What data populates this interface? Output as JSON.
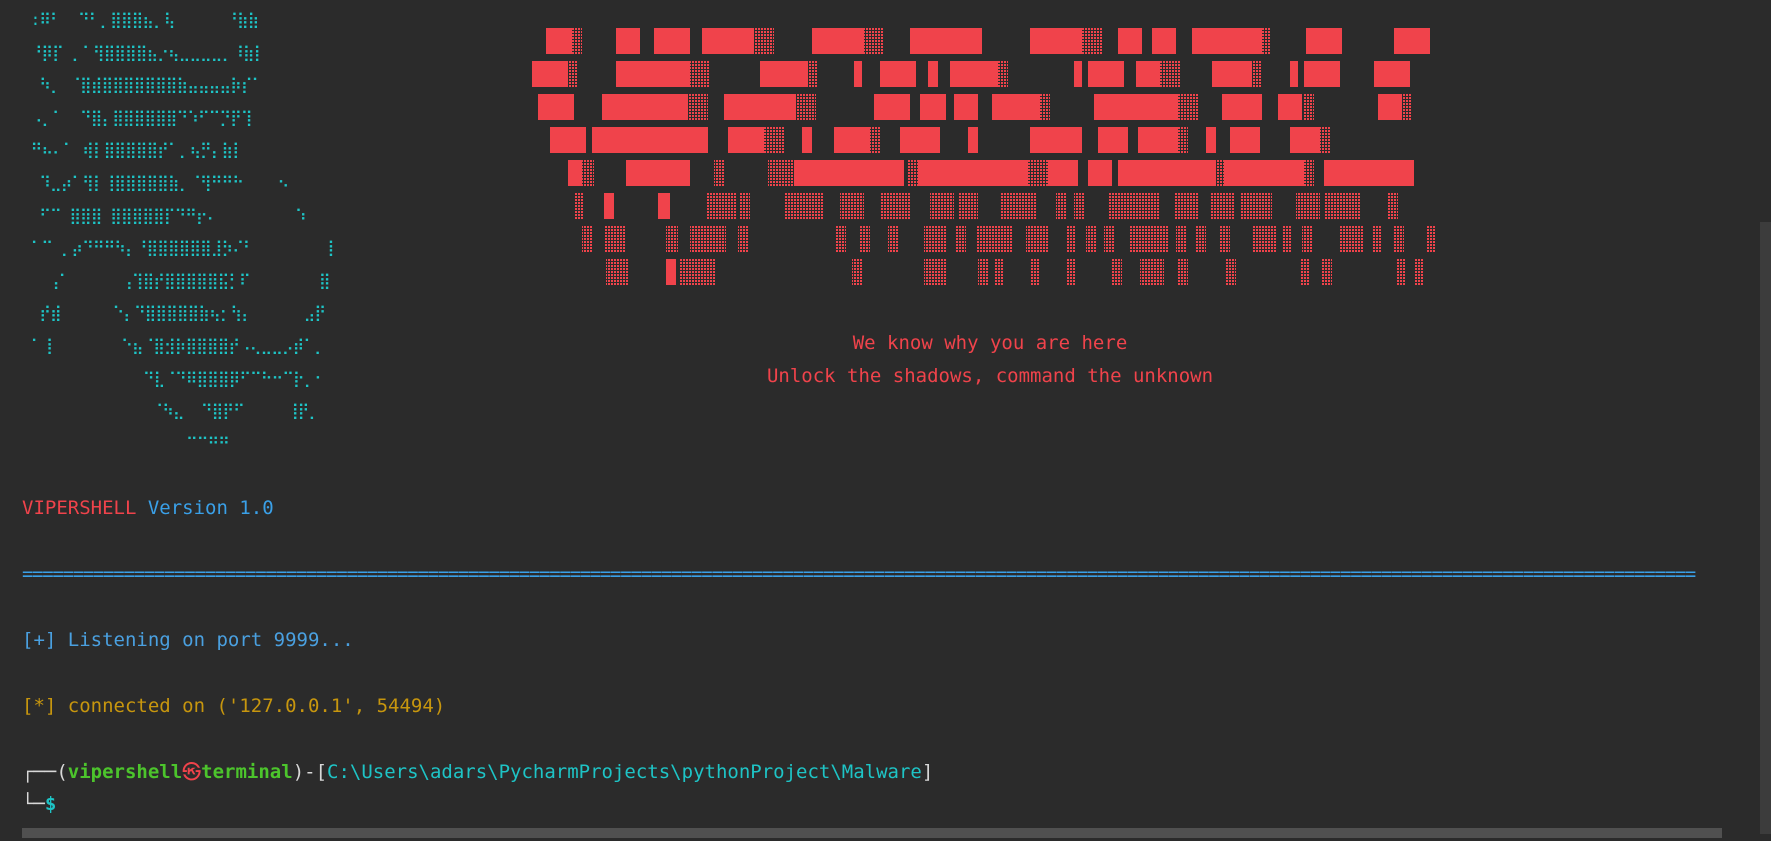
{
  "ascii_art": {
    "skull": " :⠿⠃  ⠙⠃⡀⣿⣿⣿⣦⡀⢧      ⠘⣷⣷\n ⠘⡿⡏ ⡀⠁⢻⣿⣿⣿⣿⣦⡐⢦⣀⣀⣀⣀⡀⠸⣷⡇\n  ⠳⡀ ⠈⣿⣾⣿⣿⣿⣿⣿⣿⣿⣷⣤⣤⣤⣤⡷⡎⠁\n ⠠⡀⠁  ⠙⣿⡄⣿⣿⣿⣿⣿⣿⠙⠱⠋⠉⡙⡟⢹\n ⠛⠦⠄⠁ ⢾⡇⣿⣿⣿⣿⣿⡞⠁⡀⢦⡛⡄⣷⡇\n  ⠹⣀⡴⠁⢻⡇⢸⣿⣿⣿⣿⣿⣷⡀⠈⢻⠛⠛⠓    ⠢\n  ⠋⠉ ⣿⣿⣿ ⣿⣿⣿⣿⣿⡏⠙⠛⡖⠄         ⠱\n ⠁⠉ ⡀⡴⠙⠛⠛⠳⡄⠘⣿⣿⣿⣿⣿⣿⣸⡳⠌⠃        ⢸\n   ⢠⠁      ⢠⢹⣿⡞⣿⣿⣿⣿⣿⣯⡃⠏        ⣿\n  ⡞⣾      ⠑⡄⠙⣿⣿⣿⣿⣿⣷⢦⡂⢳⡄      ⣠⡟\n ⠁⢸        ⠑⣦⠈⣿⣺⡷⣿⣿⣿⣿⡞⠠⢄⣀⣀⡠⡾⠁⡀\n              ⠙⣇⠈⠙⠿⣿⣿⣿⡿⠋⠉⠓⠒⠉⡗⡀⠂\n               ⠈⠳⣄  ⠙⣿⡟⠋     ⢸⡟⡀\n                   ⠉⠉⠛⠛"
  },
  "banner": {
    "color": "#f0434b",
    "tagline_1": "We know why you are here",
    "tagline_2": "Unlock the shadows, command the unknown"
  },
  "version": {
    "name": "VIPERSHELL",
    "label": "Version 1.0"
  },
  "divider": "=====================================================================================================================================================================",
  "messages": {
    "listening": "[+] Listening on port 9999...",
    "connected": "[*] connected on ('127.0.0.1', 54494)"
  },
  "prompt": {
    "corner_top": "┌──(",
    "user": "vipershell",
    "skull_glyph": "㉿",
    "host": "terminal",
    "separator": ")-[",
    "path": "C:\\Users\\adars\\PycharmProjects\\pythonProject\\Malware",
    "close": "]",
    "corner_bottom": "└─",
    "symbol": "$"
  },
  "colors": {
    "background": "#2b2b2b",
    "red": "#f0434b",
    "cyan": "#1ec4c6",
    "blue": "#3aa0e8",
    "amber": "#c7960e",
    "green": "#4cc42c"
  }
}
